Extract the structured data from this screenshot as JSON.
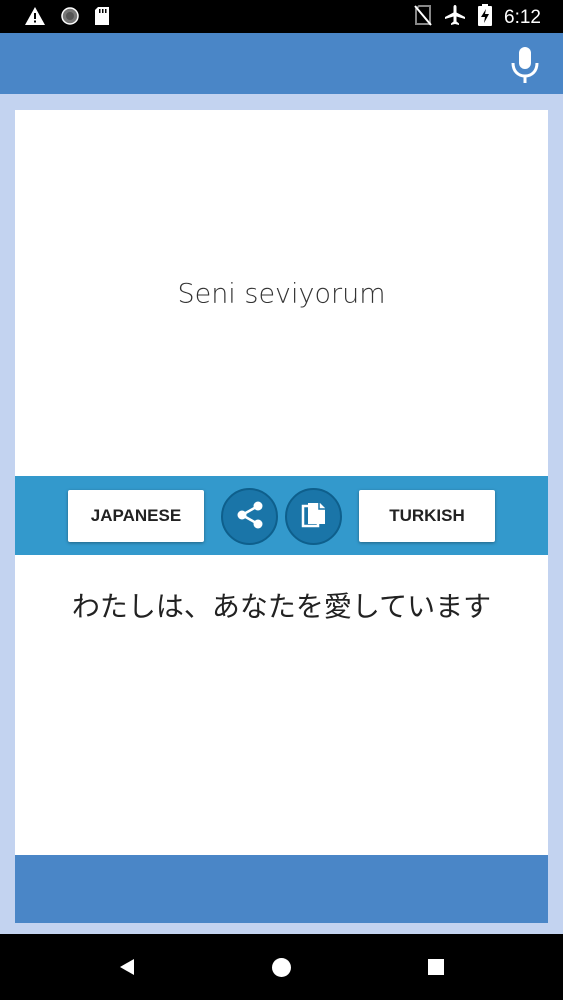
{
  "status_bar": {
    "time": "6:12",
    "icons": [
      "warning-icon",
      "sync-circle-icon",
      "sd-card-icon",
      "no-sim-icon",
      "airplane-icon",
      "battery-charging-icon"
    ]
  },
  "app_bar": {
    "action_icon": "mic-icon"
  },
  "source": {
    "text": "Seni seviyorum"
  },
  "controls": {
    "left_language": "JAPANESE",
    "right_language": "TURKISH",
    "share_icon": "share-icon",
    "copy_icon": "copy-icon"
  },
  "result": {
    "text": "わたしは、あなたを愛しています"
  },
  "nav_bar": {
    "icons": [
      "back-icon",
      "home-icon",
      "recents-icon"
    ]
  },
  "colors": {
    "app_bar": "#4a86c7",
    "control_bar": "#3399cc",
    "round_button": "#1a75a8",
    "background": "#c3d3f0"
  }
}
